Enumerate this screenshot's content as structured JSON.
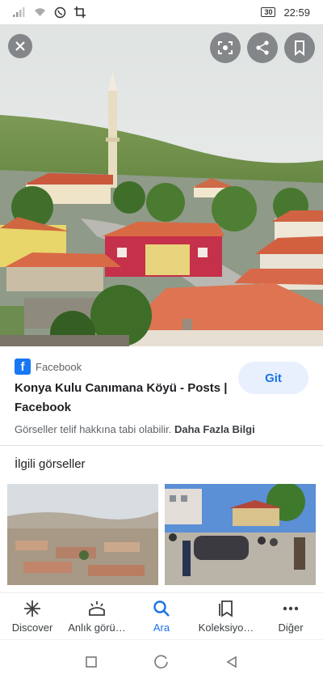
{
  "status_bar": {
    "time": "22:59",
    "battery": "30"
  },
  "result": {
    "source": "Facebook",
    "title": "Konya Kulu Canımana Köyü - Posts | Facebook",
    "visit_label": "Git",
    "notice": "Görseller telif hakkına tabi olabilir.",
    "more_info": "Daha Fazla Bilgi"
  },
  "related": {
    "heading": "İlgili görseller"
  },
  "bottom_nav": {
    "items": [
      {
        "label": "Discover",
        "icon": "asterisk-icon"
      },
      {
        "label": "Anlık görü…",
        "icon": "updates-icon"
      },
      {
        "label": "Ara",
        "icon": "search-icon"
      },
      {
        "label": "Koleksiyo…",
        "icon": "collections-icon"
      },
      {
        "label": "Diğer",
        "icon": "more-dots-icon"
      }
    ],
    "active_index": 2
  },
  "colors": {
    "accent": "#1a73e8",
    "facebook": "#1877f2",
    "visit_bg": "#e8f0fe"
  }
}
